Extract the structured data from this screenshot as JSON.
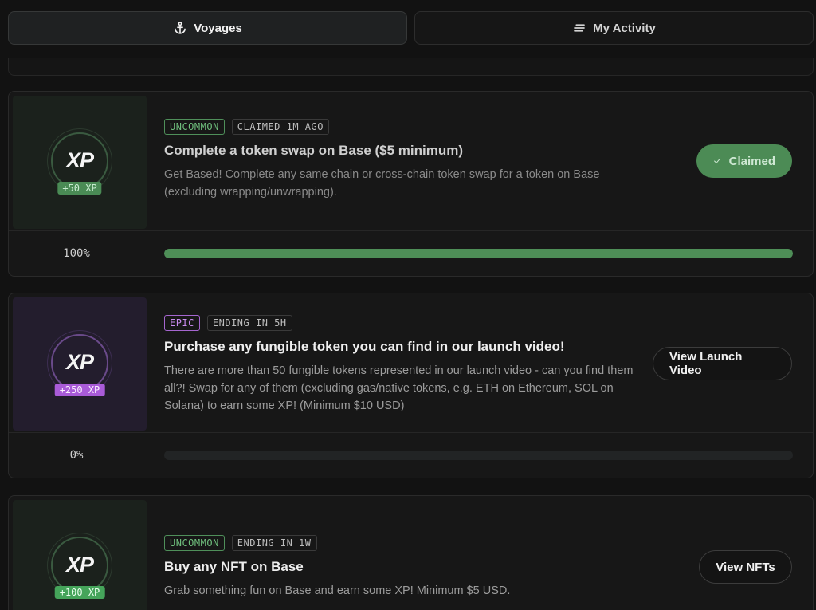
{
  "tabs": [
    {
      "label": "Voyages",
      "icon": "anchor-icon",
      "active": true
    },
    {
      "label": "My Activity",
      "icon": "list-icon",
      "active": false
    }
  ],
  "colors": {
    "uncommon": "#6fbf7d",
    "epic": "#c98bef",
    "claimed_bg": "#4c8b55",
    "progress_fill": "#4e8e57"
  },
  "quests": [
    {
      "rarity": "UNCOMMON",
      "status": "CLAIMED 1M AGO",
      "title": "Complete a token swap on Base ($5 minimum)",
      "description": "Get Based! Complete any same chain or cross-chain token swap for a token on Base (excluding wrapping/unwrapping).",
      "xp_logo": "XP",
      "xp_reward": "+50 XP",
      "action_label": "Claimed",
      "action_icon": "check-icon",
      "progress_label": "100%",
      "progress": 1.0
    },
    {
      "rarity": "EPIC",
      "status": "ENDING IN 5H",
      "title": "Purchase any fungible token you can find in our launch video!",
      "description": "There are more than 50 fungible tokens represented in our launch video - can you find them all?! Swap for any of them (excluding gas/native tokens, e.g. ETH on Ethereum, SOL on Solana) to earn some XP! (Minimum $10 USD)",
      "xp_logo": "XP",
      "xp_reward": "+250 XP",
      "action_label": "View Launch Video",
      "progress_label": "0%",
      "progress": 0.0
    },
    {
      "rarity": "UNCOMMON",
      "status": "ENDING IN 1W",
      "title": "Buy any NFT on Base",
      "description": "Grab something fun on Base and earn some XP! Minimum $5 USD.",
      "xp_logo": "XP",
      "xp_reward": "+100 XP",
      "action_label": "View NFTs"
    }
  ]
}
